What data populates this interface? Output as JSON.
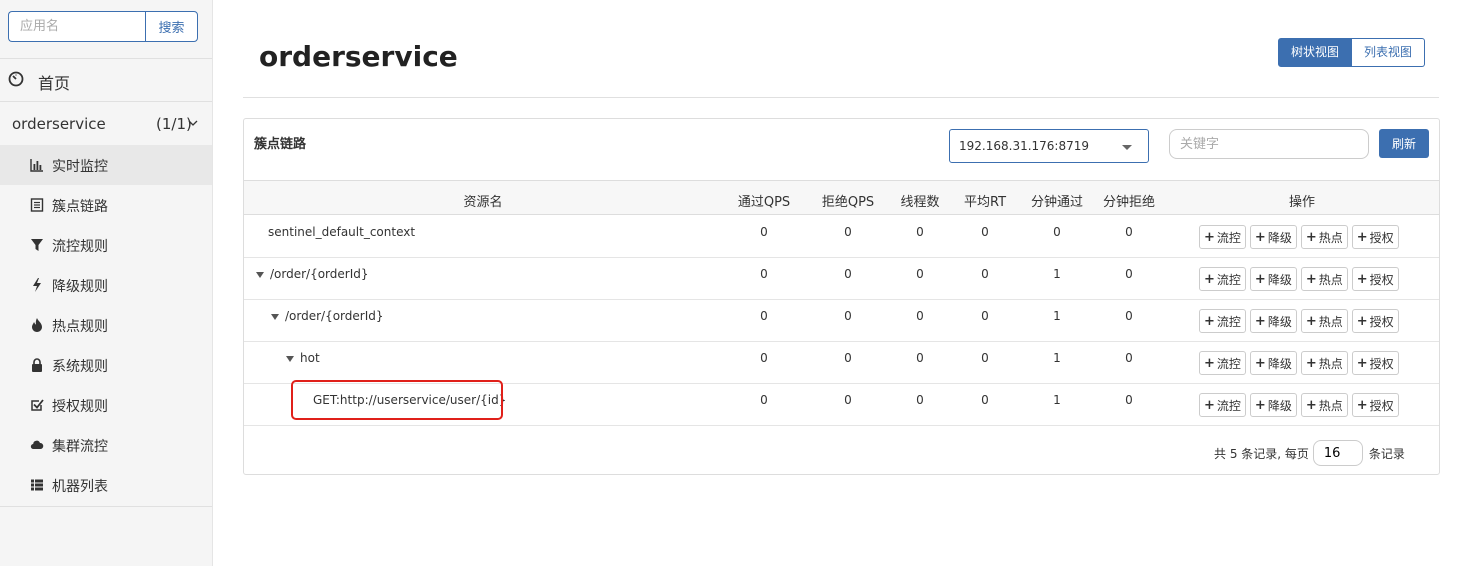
{
  "sidebar": {
    "search": {
      "placeholder": "应用名",
      "button_label": "搜索"
    },
    "home_label": "首页",
    "app": {
      "name": "orderservice",
      "count": "(1/1)"
    },
    "items": [
      {
        "label": "实时监控",
        "icon": "bar-chart-icon",
        "active": true
      },
      {
        "label": "簇点链路",
        "icon": "list-icon"
      },
      {
        "label": "流控规则",
        "icon": "filter-icon"
      },
      {
        "label": "降级规则",
        "icon": "bolt-icon"
      },
      {
        "label": "热点规则",
        "icon": "fire-icon"
      },
      {
        "label": "系统规则",
        "icon": "lock-icon"
      },
      {
        "label": "授权规则",
        "icon": "check-square-icon"
      },
      {
        "label": "集群流控",
        "icon": "cloud-icon"
      },
      {
        "label": "机器列表",
        "icon": "th-list-icon"
      }
    ]
  },
  "page": {
    "title": "orderservice",
    "view_toggle": {
      "tree": "树状视图",
      "list": "列表视图"
    }
  },
  "panel": {
    "title": "簇点链路",
    "machine": "192.168.31.176:8719",
    "keyword_placeholder": "关键字",
    "refresh_label": "刷新"
  },
  "table": {
    "columns": [
      "资源名",
      "通过QPS",
      "拒绝QPS",
      "线程数",
      "平均RT",
      "分钟通过",
      "分钟拒绝",
      "操作"
    ],
    "op_labels": [
      "流控",
      "降级",
      "热点",
      "授权"
    ],
    "rows": [
      {
        "name": "sentinel_default_context",
        "level": 0,
        "expand": false,
        "values": [
          "0",
          "0",
          "0",
          "0",
          "0",
          "0"
        ]
      },
      {
        "name": "/order/{orderId}",
        "level": 0,
        "expand": true,
        "values": [
          "0",
          "0",
          "0",
          "0",
          "1",
          "0"
        ]
      },
      {
        "name": "/order/{orderId}",
        "level": 1,
        "expand": true,
        "values": [
          "0",
          "0",
          "0",
          "0",
          "1",
          "0"
        ]
      },
      {
        "name": "hot",
        "level": 2,
        "expand": true,
        "values": [
          "0",
          "0",
          "0",
          "0",
          "1",
          "0"
        ]
      },
      {
        "name": "GET:http://userservice/user/{id}",
        "level": 3,
        "expand": false,
        "values": [
          "0",
          "0",
          "0",
          "0",
          "1",
          "0"
        ],
        "highlighted": true
      }
    ]
  },
  "pager": {
    "prefix": "共 5 条记录, 每页",
    "page_size": "16",
    "suffix": "条记录"
  },
  "colors": {
    "primary": "#3c6fb0",
    "highlight": "#e0201a"
  }
}
